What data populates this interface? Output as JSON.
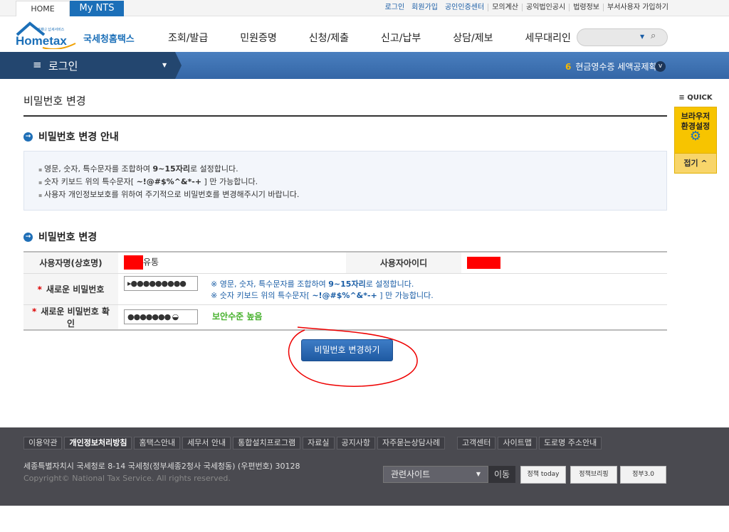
{
  "topbar": {
    "home": "HOME",
    "mynts": "My NTS",
    "links": [
      "로그인",
      "회원가입",
      "공인인증센터",
      "모의계산",
      "공익법인공시",
      "법령정보",
      "부서사용자 가입하기"
    ]
  },
  "logo": {
    "tag": "언제나 납세서비스",
    "brand": "Hometax",
    "name": "국세청홈택스"
  },
  "nav": [
    "조회/발급",
    "민원증명",
    "신청/제출",
    "신고/납부",
    "상담/제보",
    "세무대리인"
  ],
  "search": {
    "placeholder": ""
  },
  "band": {
    "login": "로그인",
    "notice_num": "6",
    "notice": "현금영수증 세액공제확..."
  },
  "page": {
    "title": "비밀번호 변경"
  },
  "guide": {
    "heading": "비밀번호 변경 안내",
    "items": [
      {
        "pre": "영문, 숫자, 특수문자를 조합하여 ",
        "bold": "9~15자리",
        "post": "로 설정합니다."
      },
      {
        "pre": "숫자 키보드 위의 특수문자[ ",
        "bold": "~!@#$%^&*-+",
        "post": " ] 만 가능합니다."
      },
      {
        "pre": "사용자 개인정보보호를 위하여 주기적으로 비밀번호를 변경해주시기 바랍니다.",
        "bold": "",
        "post": ""
      }
    ]
  },
  "form": {
    "heading": "비밀번호 변경",
    "username_label": "사용자명(상호명)",
    "username_value": "유통",
    "userid_label": "사용자아이디",
    "newpw_label": "새로운 비밀번호",
    "newpw_value": "▸●●●●●●●●●",
    "note1_pre": "※ 영문, 숫자, 특수문자를 조합하여 ",
    "note1_bold": "9~15자리",
    "note1_post": "로 설정합니다.",
    "note2_pre": "※ 숫자 키보드 위의 특수문자[ ",
    "note2_bold": "~!@#$%^&*-+",
    "note2_post": " ] 만 가능합니다.",
    "confirm_label": "새로운 비밀번호 확인",
    "confirm_value": "●●●●●●● ◒",
    "strength": "보안수준 높음",
    "submit": "비밀번호 변경하기"
  },
  "quick": {
    "title": "QUICK",
    "browser": "브라우저 환경설정",
    "fold": "접기 ^"
  },
  "footer": {
    "links": [
      "이용약관",
      "개인정보처리방침",
      "홈택스안내",
      "세무서 안내",
      "통합설치프로그램",
      "자료실",
      "공지사항",
      "자주묻는상담사례",
      "고객센터",
      "사이트맵",
      "도로명 주소안내"
    ],
    "address": "세종특별자치시 국세청로 8-14 국세청(정부세종2청사 국세청동) (우편번호) 30128",
    "copyright": "Copyright© National Tax Service. All rights reserved.",
    "related": "관련사이트",
    "go": "이동",
    "banners": [
      "정책 today",
      "정책브리핑",
      "정부3.0"
    ]
  },
  "colors": {
    "brand": "#1b6fb8",
    "navband": "#3466a6",
    "footer": "#4a4a50",
    "strength": "#44b02a"
  }
}
